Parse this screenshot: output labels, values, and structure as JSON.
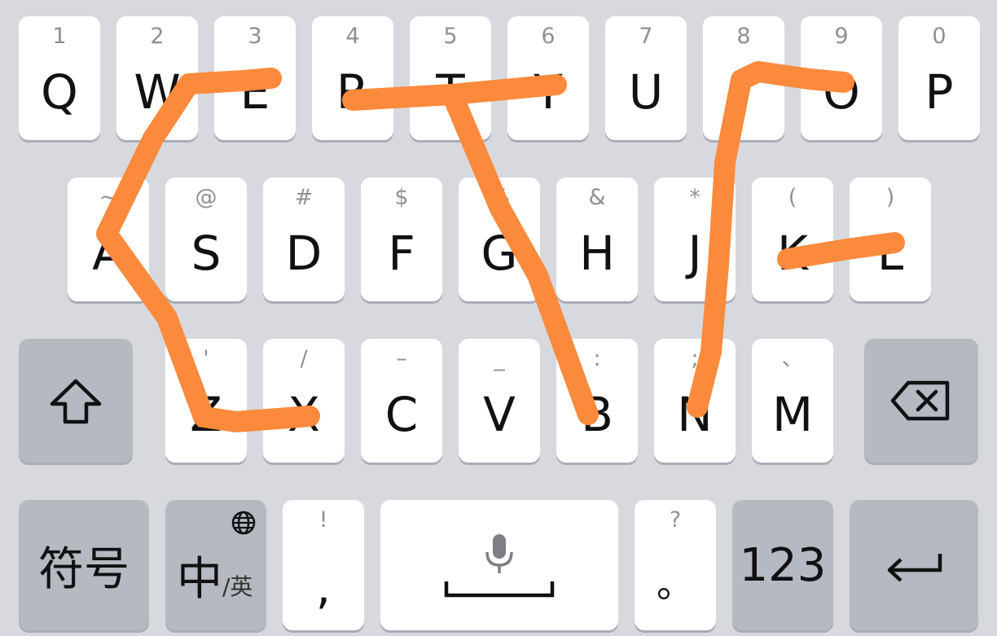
{
  "keyboard": {
    "row1": [
      {
        "main": "Q",
        "sub": "1"
      },
      {
        "main": "W",
        "sub": "2"
      },
      {
        "main": "E",
        "sub": "3"
      },
      {
        "main": "R",
        "sub": "4"
      },
      {
        "main": "T",
        "sub": "5"
      },
      {
        "main": "Y",
        "sub": "6"
      },
      {
        "main": "U",
        "sub": "7"
      },
      {
        "main": "I",
        "sub": "8"
      },
      {
        "main": "O",
        "sub": "9"
      },
      {
        "main": "P",
        "sub": "0"
      }
    ],
    "row2": [
      {
        "main": "A",
        "sub": "~"
      },
      {
        "main": "S",
        "sub": "@"
      },
      {
        "main": "D",
        "sub": "#"
      },
      {
        "main": "F",
        "sub": "$"
      },
      {
        "main": "G",
        "sub": "%"
      },
      {
        "main": "H",
        "sub": "&"
      },
      {
        "main": "J",
        "sub": "*"
      },
      {
        "main": "K",
        "sub": "("
      },
      {
        "main": "L",
        "sub": ")"
      }
    ],
    "row3": [
      {
        "main": "Z",
        "sub": "'"
      },
      {
        "main": "X",
        "sub": "/"
      },
      {
        "main": "C",
        "sub": "–"
      },
      {
        "main": "V",
        "sub": "_"
      },
      {
        "main": "B",
        "sub": ":"
      },
      {
        "main": "N",
        "sub": ";"
      },
      {
        "main": "M",
        "sub": "、"
      }
    ],
    "shift_icon": "shift-arrow-icon",
    "backspace_icon": "backspace-icon",
    "symbols_label": "符号",
    "lang_main": "中",
    "lang_sub": "/英",
    "globe_icon": "globe-icon",
    "comma_main": ",",
    "comma_sub": "!",
    "space_icon": "microphone-icon",
    "period_main": "。",
    "period_sub": "?",
    "numbers_label": "123",
    "enter_icon": "enter-arrow-icon"
  },
  "colors": {
    "background": "#d7d9de",
    "key": "#ffffff",
    "function_key": "#b4b9c2",
    "swipe_trail": "#fb8a3c"
  }
}
